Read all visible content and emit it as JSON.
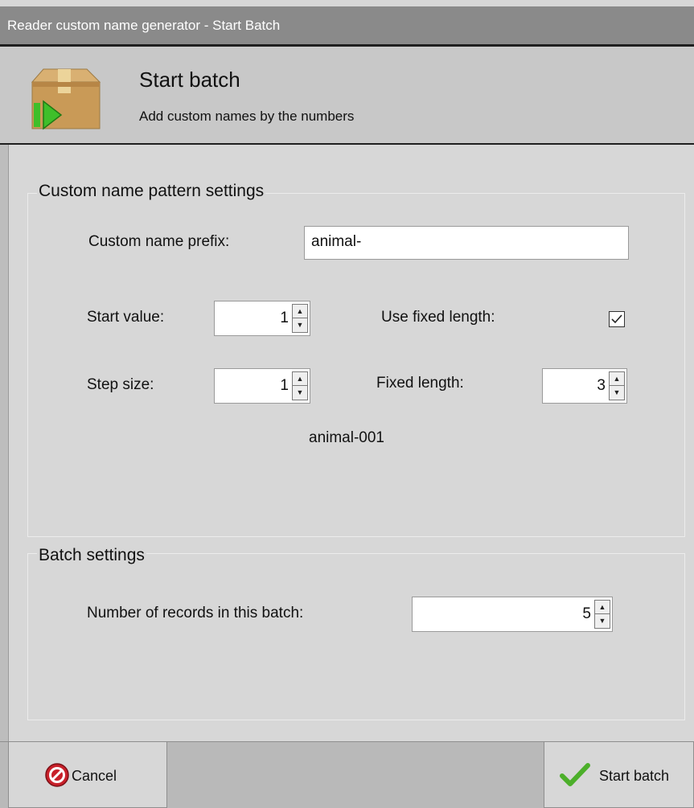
{
  "window": {
    "title": "Reader custom name generator - Start Batch"
  },
  "header": {
    "title": "Start batch",
    "subtitle": "Add custom names by the numbers",
    "icon": "package-play-icon"
  },
  "pattern_group": {
    "title": "Custom name pattern settings",
    "prefix_label": "Custom name prefix:",
    "prefix_value": "animal-",
    "start_label": "Start value:",
    "start_value": "1",
    "step_label": "Step size:",
    "step_value": "1",
    "fixed_length_toggle_label": "Use fixed length:",
    "fixed_length_checked": true,
    "fixed_length_label": "Fixed length:",
    "fixed_length_value": "3",
    "preview": "animal-001"
  },
  "batch_group": {
    "title": "Batch settings",
    "records_label": "Number of records in this batch:",
    "records_value": "5"
  },
  "footer": {
    "cancel_label": "Cancel",
    "start_label": "Start batch"
  },
  "colors": {
    "titlebar": "#8a8a8a",
    "window_bg": "#d7d7d7",
    "header_bg": "#c8c8c8",
    "play_green": "#3fbf2a",
    "cancel_red": "#c8202a",
    "check_green": "#4caf2a"
  }
}
